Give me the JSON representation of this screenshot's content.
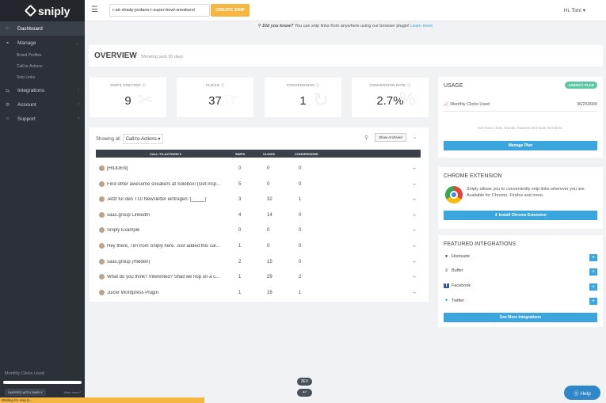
{
  "app": {
    "logo_text": "sniply"
  },
  "sidebar": {
    "items": [
      {
        "label": "Dashboard",
        "icon": "home-icon"
      },
      {
        "label": "Manage",
        "icon": "link-icon"
      },
      {
        "label": "Integrations",
        "icon": "exchange-icon"
      },
      {
        "label": "Account",
        "icon": "gear-icon"
      },
      {
        "label": "Support",
        "icon": "lightbulb-icon"
      }
    ],
    "sub_items": [
      "Brand Profiles",
      "Call-to-Actions",
      "Snip Links"
    ],
    "footer": {
      "clicks_used_label": "Monthly Clicks Used",
      "badge": "SNIPPED WITH SNIPLY",
      "more": "Want more?"
    }
  },
  "topbar": {
    "url_value": "r-air-shady-jordans-r-super-bowl-sneakers/",
    "create_label": "CREATE SNIP",
    "user_label": "Hi, Tim! ▾"
  },
  "info": {
    "prefix": "Did you know?",
    "text": " You can snip links from anywhere using our browser plugin! ",
    "link": "Learn more"
  },
  "overview": {
    "title": "OVERVIEW",
    "subtitle": "Showing past 30 days"
  },
  "stats": [
    {
      "label": "SNIPS CREATED ⓘ",
      "value": "9"
    },
    {
      "label": "CLICKS ⓘ",
      "value": "37"
    },
    {
      "label": "CONVERSIONS ⓘ",
      "value": "1"
    },
    {
      "label": "CONVERSION RATE ⓘ",
      "value": "2.7%"
    }
  ],
  "cta_table": {
    "showing_label": "Showing all",
    "filter_value": "Call-to-Actions ▾",
    "show_archived": "Show Archived",
    "headers": {
      "name": "CALL-TO-ACTIONS ▾",
      "snips": "SNIPS",
      "clicks": "CLICKS",
      "conversions": "CONVERSIONS"
    },
    "rows": [
      {
        "name": "[HIDDEN]",
        "snips": "0",
        "clicks": "0",
        "conversions": "0"
      },
      {
        "name": "Find other awesome sneakers at Solebox! (Get insp...",
        "snips": "5",
        "clicks": "0",
        "conversions": "0"
      },
      {
        "name": "Jetzt für den T10 Newsletter eintragen: [_____]",
        "snips": "3",
        "clicks": "32",
        "conversions": "1"
      },
      {
        "name": "saas.group LinkedIn",
        "snips": "4",
        "clicks": "14",
        "conversions": "0"
      },
      {
        "name": "Sniply Example",
        "snips": "0",
        "clicks": "0",
        "conversions": "0"
      },
      {
        "name": "Hey there, Tim from Sniply here. Just added this cal...",
        "snips": "1",
        "clicks": "0",
        "conversions": "0"
      },
      {
        "name": "saas.group (Hidden)",
        "snips": "2",
        "clicks": "15",
        "conversions": "0"
      },
      {
        "name": "What do you think? Interested? Shall we hop on a c...",
        "snips": "1",
        "clicks": "29",
        "conversions": "2"
      },
      {
        "name": "Juicer Wordpress Plugin",
        "snips": "1",
        "clicks": "16",
        "conversions": "1"
      }
    ]
  },
  "usage": {
    "title": "USAGE",
    "plan_badge": "AGENCY PLAN",
    "clicks_label": "Monthly Clicks Used",
    "clicks_value": "36/250000",
    "note": "Get more clicks, brands, features and team members.",
    "button": "Manage Plan"
  },
  "chrome_ext": {
    "title": "CHROME EXTENSION",
    "text": "Sniply allows you to conveniently snip links wherever you are. Available for Chrome, Firefox and more.",
    "button": "⬇ Install Chrome Extension"
  },
  "integrations": {
    "title": "FEATURED INTEGRATIONS",
    "items": [
      "Hootsuite",
      "Buffer",
      "Facebook",
      "Twitter"
    ],
    "button": "See More Integrations"
  },
  "misc": {
    "dev_badge": "3EV",
    "dev_badge2": "↩",
    "help": "ⓠ Help",
    "status": "Waiting for snip.ly..."
  }
}
